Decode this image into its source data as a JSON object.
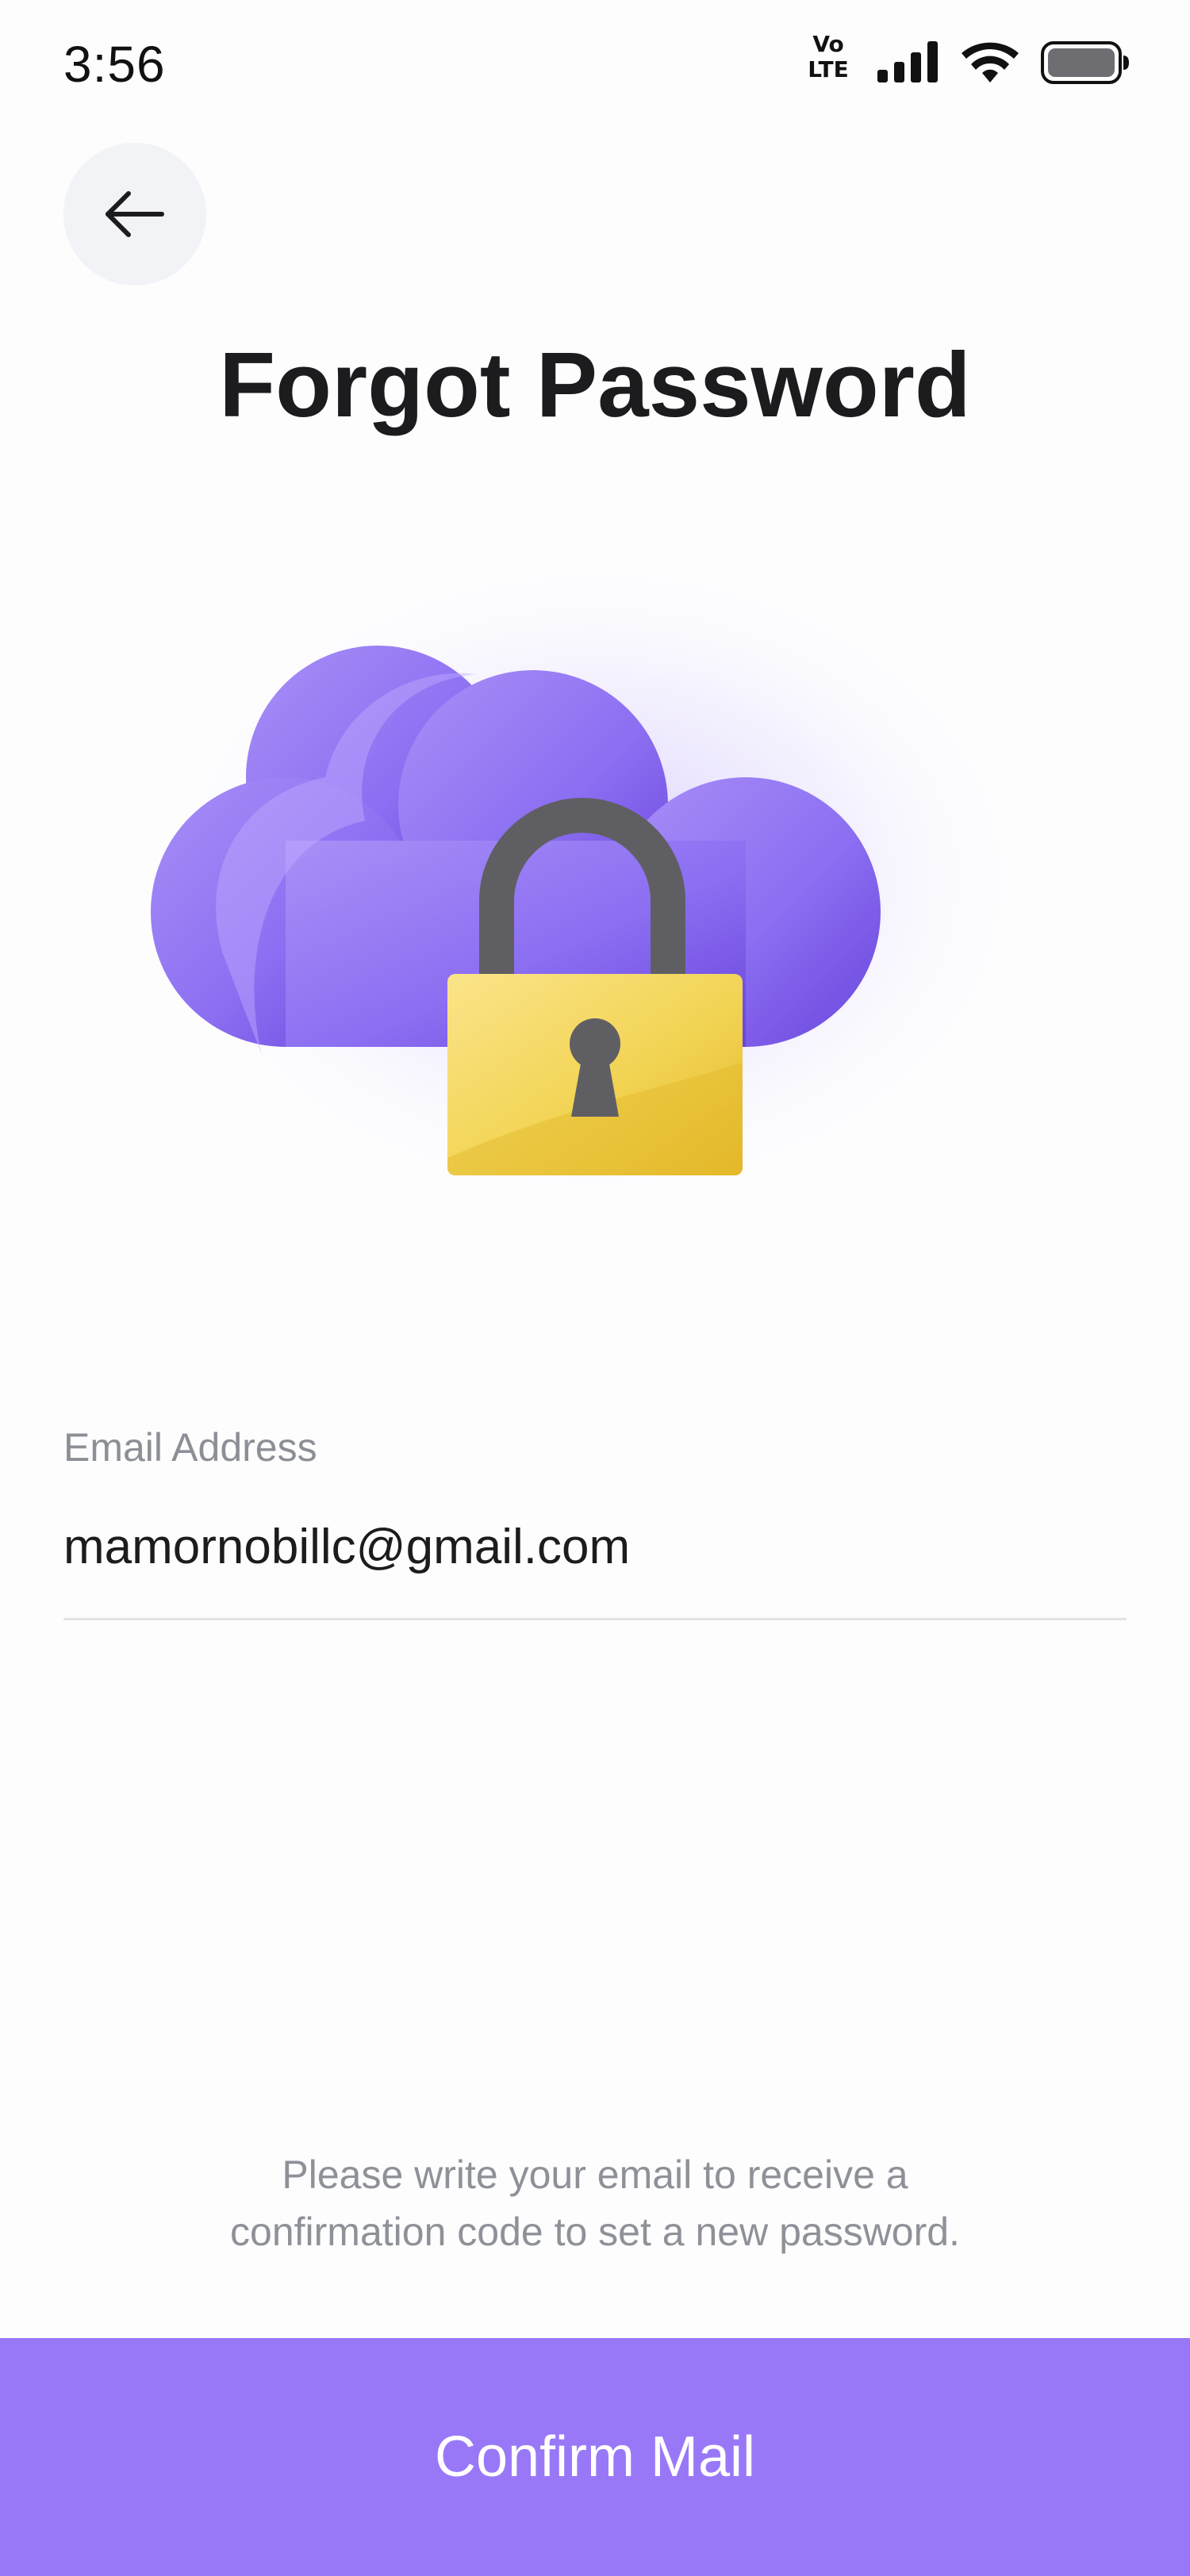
{
  "status_bar": {
    "time": "3:56",
    "volte_top": "Vo",
    "volte_bottom": "LTE",
    "signal_icon": "cellular-signal-icon",
    "wifi_icon": "wifi-icon",
    "battery_icon": "battery-icon"
  },
  "header": {
    "back_icon": "arrow-left-icon",
    "title": "Forgot Password"
  },
  "illustration": {
    "icon": "cloud-lock-icon",
    "colors": {
      "cloud": "#8a6cf2",
      "lock_body": "#f2d45c",
      "shackle": "#5f5f63"
    }
  },
  "email_field": {
    "label": "Email Address",
    "value": "mamornobillc@gmail.com",
    "placeholder": ""
  },
  "helper": {
    "line1": "Please write your email to receive a",
    "line2": "confirmation code to set a new password."
  },
  "confirm_button": {
    "label": "Confirm Mail",
    "color": "#9978f8"
  }
}
